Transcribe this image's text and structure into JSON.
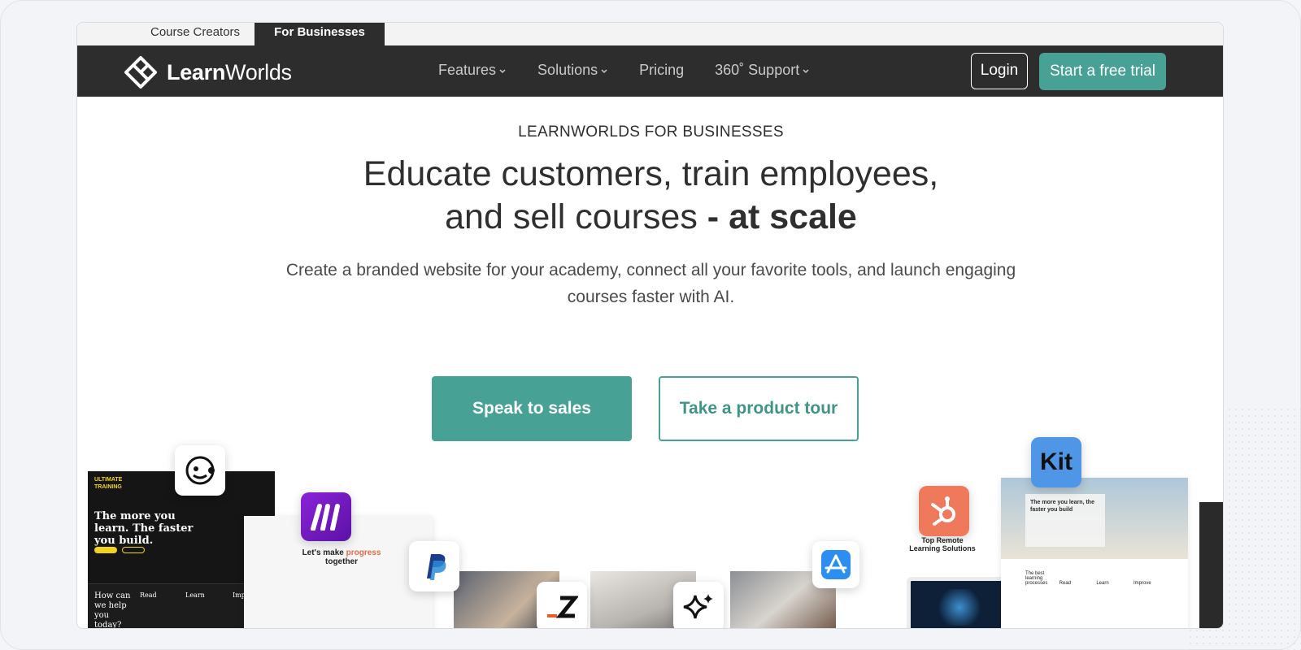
{
  "audience_tabs": [
    {
      "label": "Course Creators",
      "active": false
    },
    {
      "label": "For Businesses",
      "active": true
    }
  ],
  "brand": {
    "name_bold": "Learn",
    "name_rest": "Worlds",
    "accent": "#47a195",
    "nav_bg": "#2d2d2d"
  },
  "nav": {
    "items": [
      {
        "label": "Features",
        "has_dropdown": true
      },
      {
        "label": "Solutions",
        "has_dropdown": true
      },
      {
        "label": "Pricing",
        "has_dropdown": false
      },
      {
        "label": "360˚ Support",
        "has_dropdown": true
      }
    ],
    "login_label": "Login",
    "trial_label": "Start a free trial"
  },
  "hero": {
    "eyebrow": "LEARNWORLDS FOR BUSINESSES",
    "headline_line1": "Educate customers, train employees,",
    "headline_line2_plain": "and sell courses ",
    "headline_line2_bold": "- at scale",
    "subtitle": "Create a branded website for your academy, connect all your favorite tools, and launch engaging courses faster with AI.",
    "primary_cta": "Speak to sales",
    "secondary_cta": "Take a product tour"
  },
  "collage": {
    "training_card": {
      "tag_line1": "ULTIMATE",
      "tag_line2": "TRAINING",
      "headline": "The more you learn. The faster you build.",
      "question": "How can we help you today?",
      "col1": "Read",
      "col2": "Learn",
      "col3": "Impro"
    },
    "progress_card": {
      "text": "Let's make ",
      "highlight": "progress",
      "text2": "together"
    },
    "solutions_card": {
      "title": "Top Remote Learning Solutions"
    },
    "construction_card": {
      "headline": "The more you learn, the faster you build",
      "cols": [
        "The best learning processes",
        "Read",
        "Learn",
        "Improve"
      ]
    },
    "kit_label": "Kit"
  }
}
